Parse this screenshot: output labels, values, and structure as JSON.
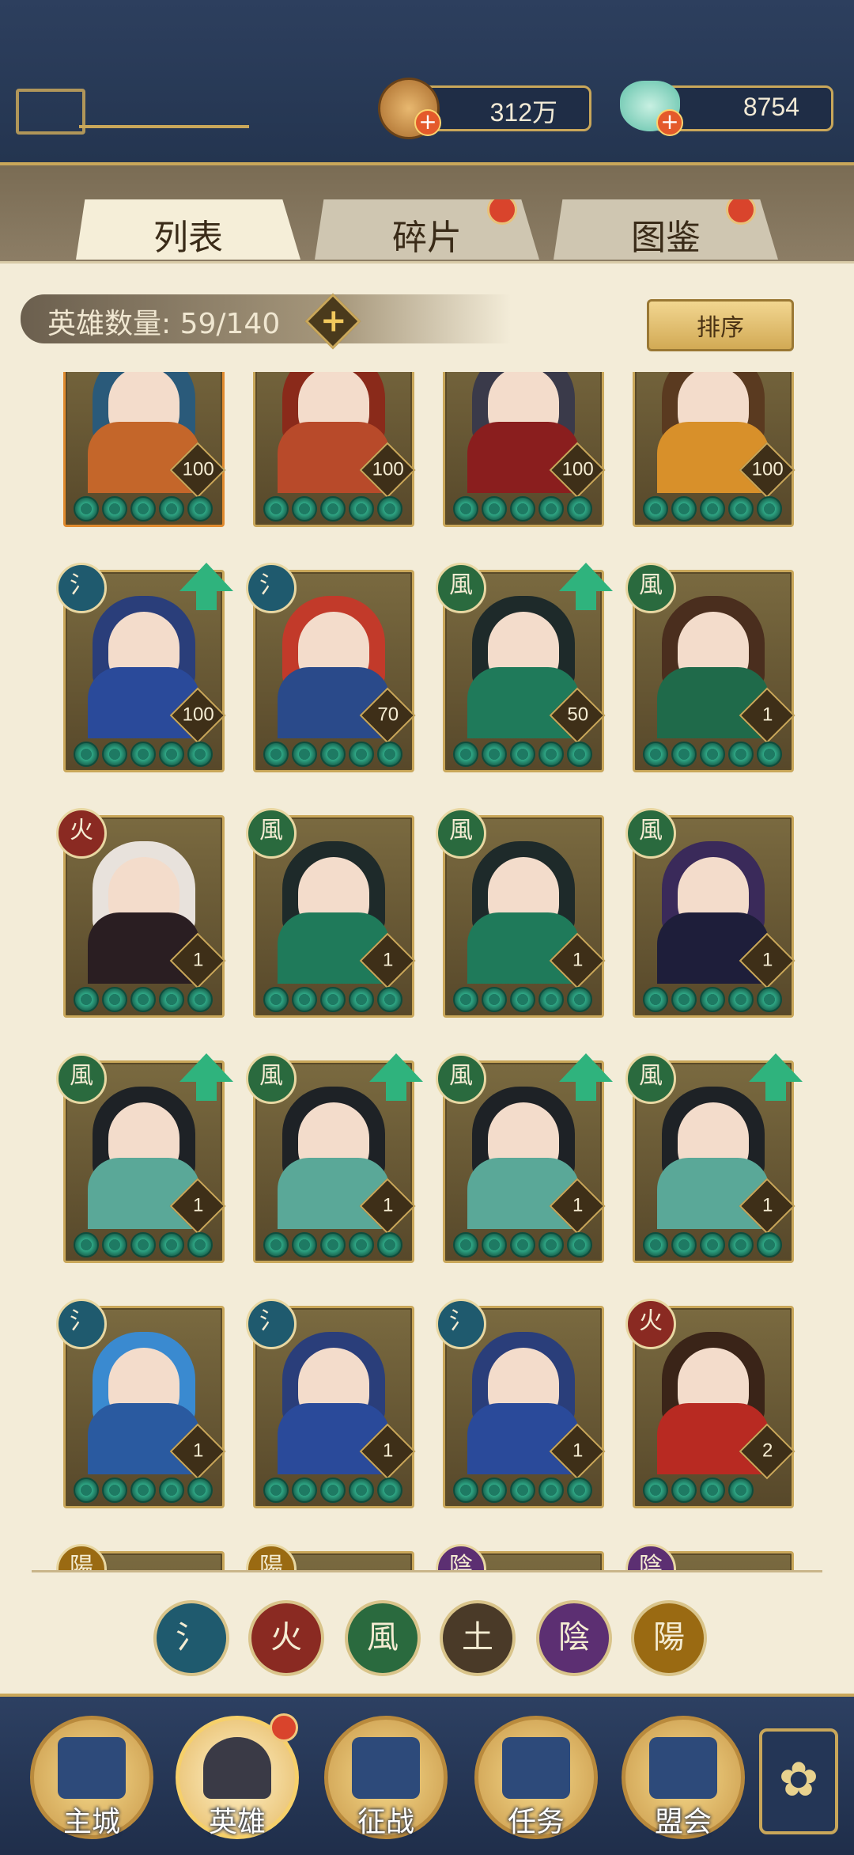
{
  "resources": {
    "coins": {
      "value": "312万",
      "icon": "copper-coin-icon"
    },
    "jade": {
      "value": "8754",
      "icon": "jade-gem-icon"
    },
    "plus_symbol": "+"
  },
  "tabs": [
    {
      "label": "列表",
      "active": true,
      "badge": false
    },
    {
      "label": "碎片",
      "active": false,
      "badge": true
    },
    {
      "label": "图鉴",
      "active": false,
      "badge": true
    }
  ],
  "hero_count": {
    "text": "英雄数量: 59/140",
    "plus": "+"
  },
  "sort_button": {
    "label": "排序"
  },
  "elements": {
    "water": {
      "glyph": "氵",
      "color": "#1f5a6e"
    },
    "fire": {
      "glyph": "火",
      "color": "#8a2a22"
    },
    "wind": {
      "glyph": "風",
      "color": "#2a6a3e"
    },
    "earth": {
      "glyph": "土",
      "color": "#4a3a28"
    },
    "yin": {
      "glyph": "陰",
      "color": "#5c2f72"
    },
    "yang": {
      "glyph": "陽",
      "color": "#9a6a12"
    }
  },
  "heroes": [
    {
      "level": "100",
      "stars": 5,
      "element": null,
      "upgrade": false,
      "hair": "#2a5a7a",
      "body": "#c4662a",
      "frame": "orange"
    },
    {
      "level": "100",
      "stars": 5,
      "element": null,
      "upgrade": false,
      "hair": "#8a2a1a",
      "body": "#b84a2a",
      "frame": "gold"
    },
    {
      "level": "100",
      "stars": 5,
      "element": null,
      "upgrade": false,
      "hair": "#3a3a4a",
      "body": "#8a1e1e",
      "frame": "gold"
    },
    {
      "level": "100",
      "stars": 5,
      "element": null,
      "upgrade": false,
      "hair": "#5a3a20",
      "body": "#d8902a",
      "frame": "gold"
    },
    {
      "level": "100",
      "stars": 5,
      "element": "water",
      "upgrade": true,
      "hair": "#2a3e7a",
      "body": "#2a4a9a",
      "frame": "gold"
    },
    {
      "level": "70",
      "stars": 5,
      "element": "water",
      "upgrade": false,
      "hair": "#c23a2a",
      "body": "#2a4a8a",
      "frame": "gold"
    },
    {
      "level": "50",
      "stars": 5,
      "element": "wind",
      "upgrade": true,
      "hair": "#1e2a2a",
      "body": "#1f7a5a",
      "frame": "gold"
    },
    {
      "level": "1",
      "stars": 5,
      "element": "wind",
      "upgrade": false,
      "hair": "#4a2e1e",
      "body": "#1f6a4a",
      "frame": "gold"
    },
    {
      "level": "1",
      "stars": 5,
      "element": "fire",
      "upgrade": false,
      "hair": "#e8e2dc",
      "body": "#2a1e22",
      "frame": "gold"
    },
    {
      "level": "1",
      "stars": 5,
      "element": "wind",
      "upgrade": false,
      "hair": "#1e2a2a",
      "body": "#1f7a5a",
      "frame": "gold"
    },
    {
      "level": "1",
      "stars": 5,
      "element": "wind",
      "upgrade": false,
      "hair": "#1e2a2a",
      "body": "#1f7a5a",
      "frame": "gold"
    },
    {
      "level": "1",
      "stars": 5,
      "element": "wind",
      "upgrade": false,
      "hair": "#3a2a5a",
      "body": "#1e1e3a",
      "frame": "gold"
    },
    {
      "level": "1",
      "stars": 5,
      "element": "wind",
      "upgrade": true,
      "hair": "#1e2226",
      "body": "#5aa898",
      "frame": "gold"
    },
    {
      "level": "1",
      "stars": 5,
      "element": "wind",
      "upgrade": true,
      "hair": "#1e2226",
      "body": "#5aa898",
      "frame": "gold"
    },
    {
      "level": "1",
      "stars": 5,
      "element": "wind",
      "upgrade": true,
      "hair": "#1e2226",
      "body": "#5aa898",
      "frame": "gold"
    },
    {
      "level": "1",
      "stars": 5,
      "element": "wind",
      "upgrade": true,
      "hair": "#1e2226",
      "body": "#5aa898",
      "frame": "gold"
    },
    {
      "level": "1",
      "stars": 5,
      "element": "water",
      "upgrade": false,
      "hair": "#3a8ad0",
      "body": "#2a5aa0",
      "frame": "gold"
    },
    {
      "level": "1",
      "stars": 5,
      "element": "water",
      "upgrade": false,
      "hair": "#2a3e7a",
      "body": "#2a4a9a",
      "frame": "gold"
    },
    {
      "level": "1",
      "stars": 5,
      "element": "water",
      "upgrade": false,
      "hair": "#2a3e7a",
      "body": "#2a4a9a",
      "frame": "gold"
    },
    {
      "level": "2",
      "stars": 4,
      "element": "fire",
      "upgrade": false,
      "hair": "#3a2418",
      "body": "#b82a22",
      "frame": "gold"
    },
    {
      "level": "",
      "stars": 0,
      "element": "yang",
      "upgrade": false,
      "hair": "#8a7a60",
      "body": "#6a5a40",
      "frame": "gold"
    },
    {
      "level": "",
      "stars": 0,
      "element": "yang",
      "upgrade": false,
      "hair": "#8a7a60",
      "body": "#6a5a40",
      "frame": "gold"
    },
    {
      "level": "",
      "stars": 0,
      "element": "yin",
      "upgrade": false,
      "hair": "#8a7a60",
      "body": "#6a5a40",
      "frame": "gold"
    },
    {
      "level": "",
      "stars": 0,
      "element": "yin",
      "upgrade": false,
      "hair": "#8a7a60",
      "body": "#6a5a40",
      "frame": "gold"
    }
  ],
  "element_filters": [
    "water",
    "fire",
    "wind",
    "earth",
    "yin",
    "yang"
  ],
  "nav": [
    {
      "label": "主城",
      "icon": "city-gate-icon",
      "active": false,
      "badge": false
    },
    {
      "label": "英雄",
      "icon": "hero-portrait-icon",
      "active": true,
      "badge": true
    },
    {
      "label": "征战",
      "icon": "battle-scroll-icon",
      "active": false,
      "badge": false
    },
    {
      "label": "任务",
      "icon": "quest-scroll-icon",
      "active": false,
      "badge": false
    },
    {
      "label": "盟会",
      "icon": "alliance-pavilion-icon",
      "active": false,
      "badge": false
    }
  ],
  "more_button": {
    "icon": "flower-menu-icon",
    "glyph": "✿"
  }
}
